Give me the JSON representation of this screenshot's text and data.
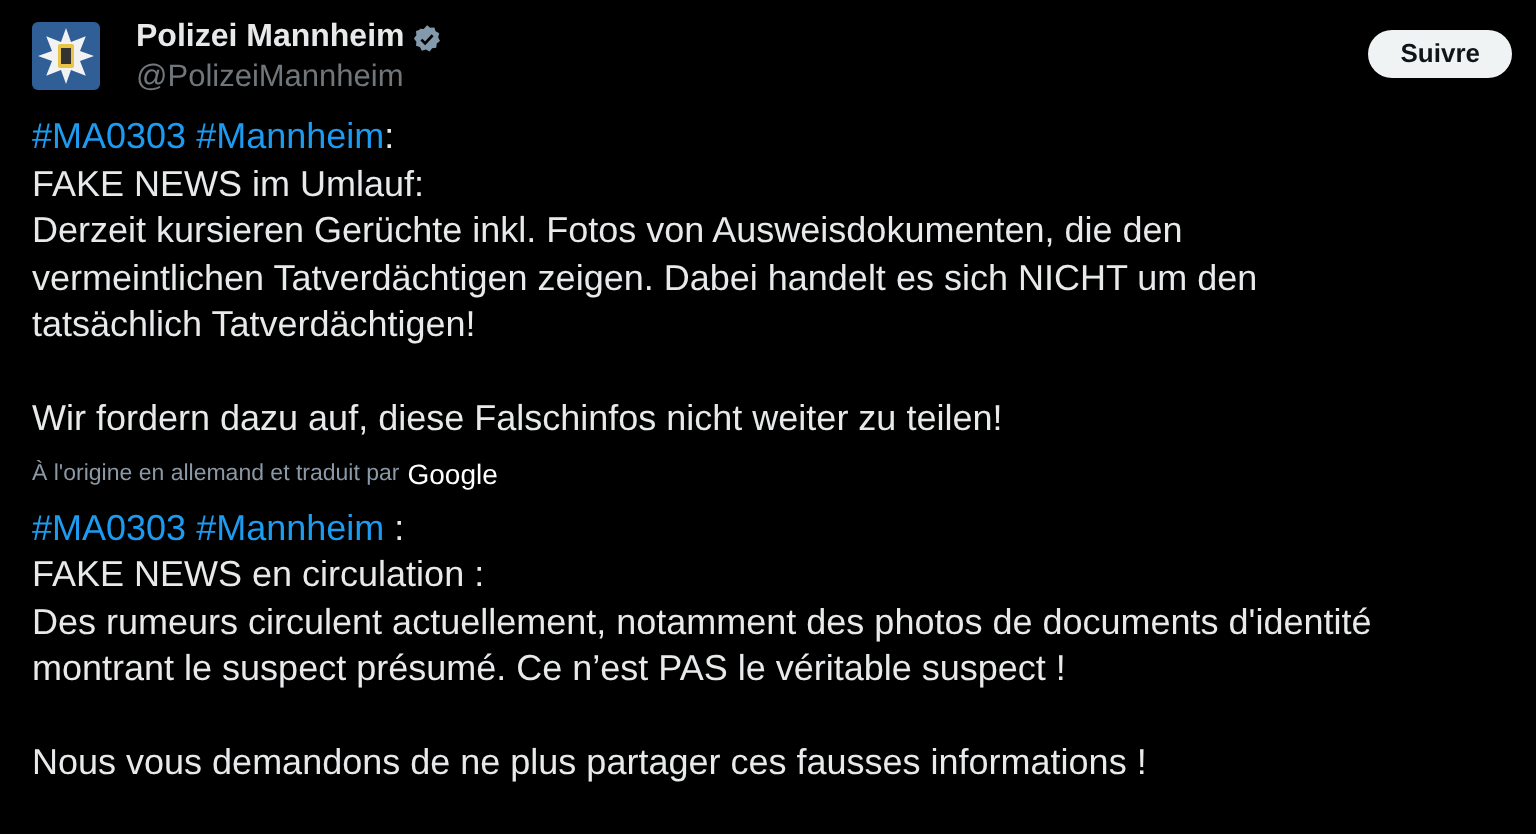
{
  "author": {
    "name": "Polizei Mannheim",
    "verified": true,
    "handle": "@PolizeiMannheim"
  },
  "follow_button": "Suivre",
  "original": {
    "heading": [
      {
        "kind": "hashtag",
        "text": "#MA0303"
      },
      {
        "kind": "hashtag",
        "text": "#Mannheim"
      },
      {
        "kind": "plain",
        "text": ":"
      }
    ],
    "paragraphs": [
      [
        "FAKE NEWS im Umlauf:",
        "Derzeit kursieren Gerüchte inkl. Fotos von Ausweisdokumenten, die den",
        "vermeintlichen Tatverdächtigen zeigen. Dabei handelt es sich NICHT um den",
        "tatsächlich Tatverdächtigen!"
      ],
      [
        "Wir fordern dazu auf, diese Falschinfos nicht weiter zu teilen!"
      ]
    ]
  },
  "translation_note": {
    "text": "À l'origine en allemand et traduit par",
    "provider": "Google"
  },
  "translation": {
    "heading": [
      {
        "kind": "hashtag",
        "text": "#MA0303"
      },
      {
        "kind": "hashtag",
        "text": "#Mannheim"
      },
      {
        "kind": "plain",
        "text": " :"
      }
    ],
    "paragraphs": [
      [
        "FAKE NEWS en circulation :",
        "Des rumeurs circulent actuellement, notamment des photos de documents d'identité",
        "montrant le suspect présumé. Ce n’est PAS le véritable suspect !"
      ],
      [
        "Nous vous demandons de ne plus partager ces fausses informations !"
      ]
    ]
  }
}
